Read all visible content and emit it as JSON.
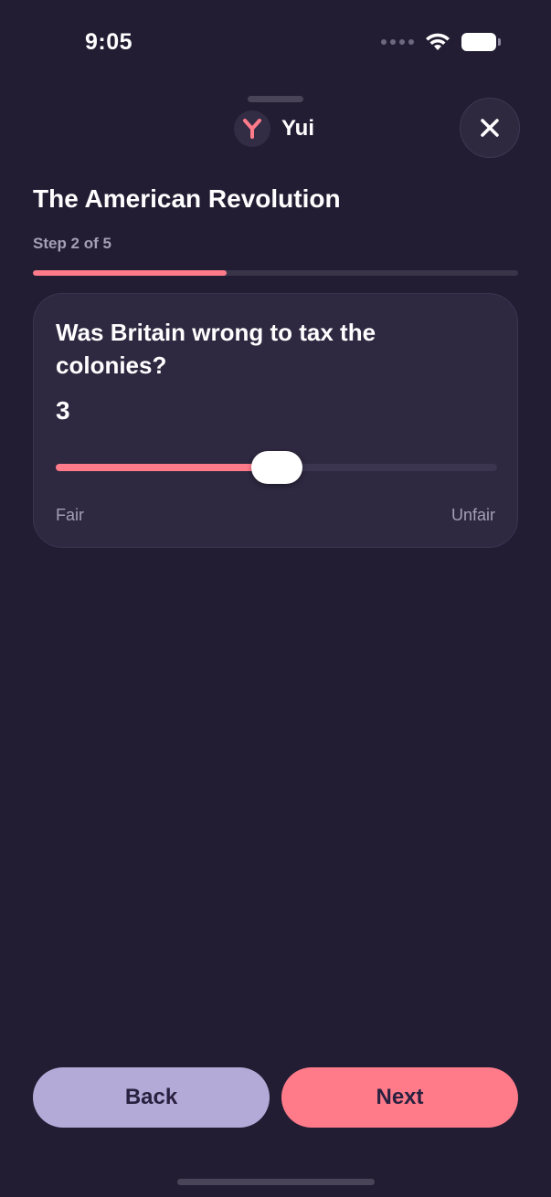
{
  "status_bar": {
    "time": "9:05"
  },
  "brand": {
    "name": "Yui",
    "logo_icon": "y-logo-icon",
    "accent": "#ff7b8a"
  },
  "header": {
    "close_icon": "close-icon"
  },
  "lesson": {
    "title": "The American Revolution",
    "step_label": "Step 2 of 5",
    "progress": 0.4
  },
  "question_card": {
    "question": "Was Britain wrong to tax the colonies?",
    "value": "3",
    "slider_fraction": 0.5,
    "min_label": "Fair",
    "max_label": "Unfair"
  },
  "footer": {
    "back_label": "Back",
    "next_label": "Next",
    "back_color": "#b3aad8",
    "next_color": "#ff7b8a"
  }
}
